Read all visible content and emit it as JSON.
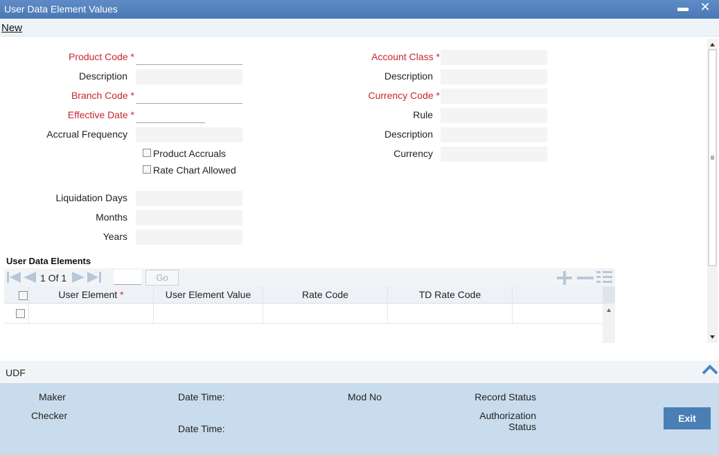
{
  "window": {
    "title": "User Data Element Values",
    "minimize": "▬",
    "close": "✕"
  },
  "menu": {
    "new": "New"
  },
  "left_form": {
    "product_code": "Product Code",
    "description": "Description",
    "branch_code": "Branch Code",
    "effective_date": "Effective Date",
    "accrual_frequency": "Accrual Frequency",
    "product_accruals": "Product Accruals",
    "rate_chart_allowed": "Rate Chart Allowed",
    "liquidation_days": "Liquidation Days",
    "months": "Months",
    "years": "Years"
  },
  "right_form": {
    "account_class": "Account Class",
    "description": "Description",
    "currency_code": "Currency Code",
    "rule": "Rule",
    "description2": "Description",
    "currency": "Currency"
  },
  "required_marker": "*",
  "section": {
    "title": "User Data Elements"
  },
  "grid": {
    "pager": "1 Of 1",
    "go": "Go",
    "columns": [
      "User Element",
      "User Element Value",
      "Rate Code",
      "TD Rate Code"
    ]
  },
  "udf": {
    "label": "UDF"
  },
  "footer": {
    "maker": "Maker",
    "checker": "Checker",
    "date_time": "Date Time:",
    "date_time2": "Date Time:",
    "mod_no": "Mod No",
    "record_status": "Record Status",
    "authorization": "Authorization",
    "status": "Status",
    "exit": "Exit"
  },
  "colors": {
    "titlebar": "#4f7db8",
    "required": "#c9252f",
    "footer": "#c9dced",
    "exit": "#4a7fb6"
  }
}
